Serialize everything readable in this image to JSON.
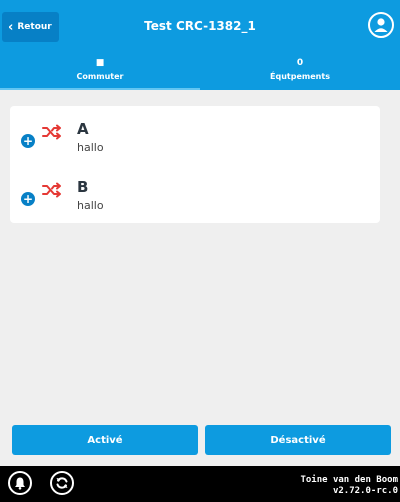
{
  "header": {
    "back_label": "Retour",
    "title": "Test CRC-1382_1",
    "avatar_icon": "user-icon"
  },
  "tabs": [
    {
      "icon_glyph": "■",
      "icon_name": "switch-icon",
      "label": "Commuter",
      "active": true
    },
    {
      "icon_glyph": "0",
      "icon_name": "count",
      "label": "Équtpements",
      "active": false
    }
  ],
  "items": [
    {
      "title": "A",
      "subtitle": "hallo",
      "add_icon": "plus-circle-icon",
      "shuffle_icon": "shuffle-icon"
    },
    {
      "title": "B",
      "subtitle": "hallo",
      "add_icon": "plus-circle-icon",
      "shuffle_icon": "shuffle-icon"
    }
  ],
  "actions": {
    "activate_label": "Activé",
    "deactivate_label": "Désactivé"
  },
  "footer": {
    "user_name": "Toine van den Boom",
    "version": "v2.72.0-rc.0",
    "bell_icon": "bell-icon",
    "refresh_icon": "refresh-icon"
  },
  "colors": {
    "header": "#0d9be0",
    "button_dark": "#0780c6",
    "shuffle": "#e53935",
    "background": "#efefef",
    "footer": "#000000"
  }
}
